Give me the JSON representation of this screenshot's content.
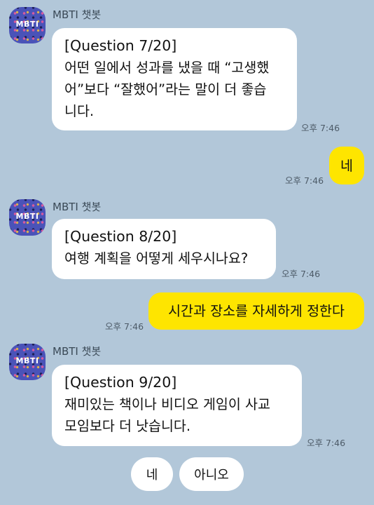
{
  "bot": {
    "name": "MBTI 챗봇",
    "avatar_text": "MBTI"
  },
  "messages": [
    {
      "question": "[Question 7/20]",
      "lines": [
        "어떤 일에서 성과를 냈을 때 “고생했",
        "어”보다 “잘했어”라는 말이 더 좋습",
        "니다."
      ],
      "time": "오후 7:46"
    },
    {
      "reply": "네",
      "time": "오후 7:46"
    },
    {
      "question": "[Question 8/20]",
      "lines": [
        "여행 계획을 어떻게 세우시나요?"
      ],
      "time": "오후 7:46"
    },
    {
      "reply": "시간과 장소를 자세하게 정한다",
      "time": "오후 7:46"
    },
    {
      "question": "[Question 9/20]",
      "lines": [
        "재미있는 책이나 비디오 게임이 사교",
        "모임보다 더 낫습니다."
      ],
      "time": "오후 7:46"
    }
  ],
  "quick_replies": [
    "네",
    "아니오"
  ]
}
